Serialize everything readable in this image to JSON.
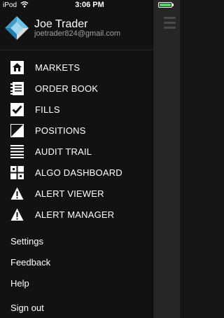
{
  "status_bar": {
    "carrier": "iPod",
    "time": "3:06 PM"
  },
  "profile": {
    "name": "Joe Trader",
    "email": "joetrader824@gmail.com"
  },
  "menu": [
    {
      "label": "MARKETS",
      "icon": "markets-icon"
    },
    {
      "label": "ORDER BOOK",
      "icon": "order-book-icon"
    },
    {
      "label": "FILLS",
      "icon": "checkmark-icon"
    },
    {
      "label": "POSITIONS",
      "icon": "positions-icon"
    },
    {
      "label": "AUDIT TRAIL",
      "icon": "audit-trail-icon"
    },
    {
      "label": "ALGO DASHBOARD",
      "icon": "algo-dashboard-icon"
    },
    {
      "label": "ALERT VIEWER",
      "icon": "warning-icon"
    },
    {
      "label": "ALERT MANAGER",
      "icon": "warning-icon"
    }
  ],
  "secondary": [
    {
      "label": "Settings"
    },
    {
      "label": "Feedback"
    },
    {
      "label": "Help"
    }
  ],
  "sign_out": "Sign out",
  "colors": {
    "background": "#121212",
    "overlay": "#262626",
    "battery": "#4cd964",
    "logo_light": "#6ec3ea",
    "logo_dark": "#1f7fb0"
  }
}
